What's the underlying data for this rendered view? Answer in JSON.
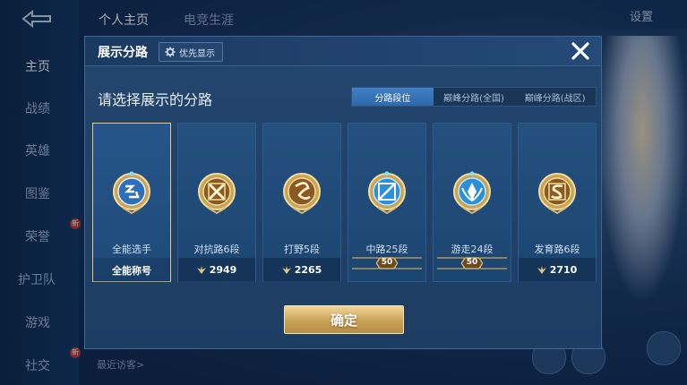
{
  "sidebar": {
    "items": [
      {
        "label": "主页",
        "active": true
      },
      {
        "label": "战绩"
      },
      {
        "label": "英雄"
      },
      {
        "label": "图鉴"
      },
      {
        "label": "荣誉",
        "badge": "新"
      },
      {
        "label": "护卫队"
      },
      {
        "label": "游戏"
      },
      {
        "label": "社交",
        "badge": "新"
      }
    ]
  },
  "top_tabs": [
    {
      "label": "个人主页",
      "active": true
    },
    {
      "label": "电竞生涯"
    }
  ],
  "top_right": {
    "settings_label": "设置"
  },
  "footer": {
    "visitors_label": "最近访客>"
  },
  "dialog": {
    "title": "展示分路",
    "pref_button_label": "优先显示",
    "subtitle": "请选择展示的分路",
    "tabs": [
      {
        "label": "分路段位",
        "active": true
      },
      {
        "label": "巅峰分路(全国)"
      },
      {
        "label": "巅峰分路(战区)"
      }
    ],
    "cards": [
      {
        "icon": "all-round-badge-icon",
        "label": "全能选手",
        "footer_text": "全能称号",
        "selected": true
      },
      {
        "icon": "clash-lane-badge-icon",
        "label": "对抗路6段",
        "points": "2949"
      },
      {
        "icon": "jungle-badge-icon",
        "label": "打野5段",
        "points": "2265"
      },
      {
        "icon": "mid-lane-badge-icon",
        "label": "中路25段",
        "stars": "50"
      },
      {
        "icon": "roam-badge-icon",
        "label": "游走24段",
        "stars": "50"
      },
      {
        "icon": "farm-lane-badge-icon",
        "label": "发育路6段",
        "points": "2710"
      }
    ],
    "confirm_label": "确定"
  },
  "colors": {
    "accent_gold": "#e7c77a",
    "tab_active": "#3f7fc4",
    "panel": "#23466f"
  }
}
